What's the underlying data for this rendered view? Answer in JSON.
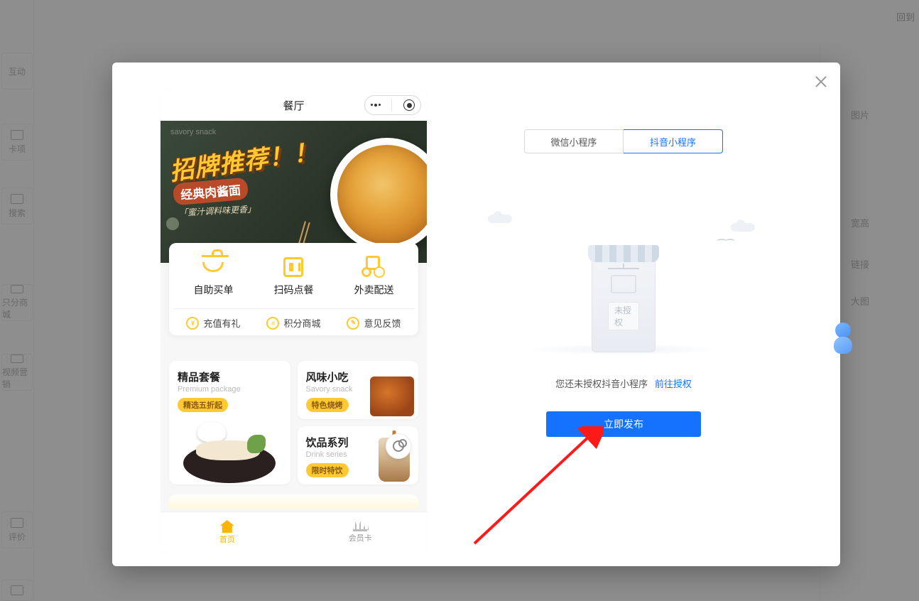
{
  "header": {
    "back": "回到"
  },
  "sidebar": {
    "items": [
      {
        "label": "互动"
      },
      {
        "label": "卡项"
      },
      {
        "label": "搜索"
      },
      {
        "label": "只分商城"
      },
      {
        "label": "视频营销"
      },
      {
        "label": "评价"
      }
    ]
  },
  "rightpanel": {
    "r1": "图片",
    "r2": "宽高",
    "r3": "链接",
    "r4": "大图"
  },
  "modal": {
    "tabs": {
      "wechat": "微信小程序",
      "douyin": "抖音小程序"
    },
    "illus_sign": "未授权",
    "auth_text": "您还未授权抖音小程序",
    "auth_link": "前往授权",
    "publish": "立即发布"
  },
  "phone": {
    "title": "餐厅",
    "banner": {
      "watermark": "savory snack",
      "title": "招牌推荐！！",
      "subtitle": "经典肉酱面",
      "script": "「蜜汁调料味更香」"
    },
    "menu": {
      "items": [
        {
          "label": "自助买单"
        },
        {
          "label": "扫码点餐"
        },
        {
          "label": "外卖配送"
        }
      ],
      "sub": [
        {
          "icon": "¥",
          "label": "充值有礼"
        },
        {
          "icon": "≡",
          "label": "积分商城"
        },
        {
          "icon": "✎",
          "label": "意见反馈"
        }
      ]
    },
    "cats": {
      "combo_title": "精品套餐",
      "combo_sub": "Premium package",
      "combo_badge": "精选五折起",
      "snack_title": "风味小吃",
      "snack_sub": "Savory snack",
      "snack_badge": "特色烧烤",
      "drink_title": "饮品系列",
      "drink_sub": "Drink series",
      "drink_badge": "限时特饮"
    },
    "tabs": {
      "home": "首页",
      "member": "会员卡"
    }
  }
}
